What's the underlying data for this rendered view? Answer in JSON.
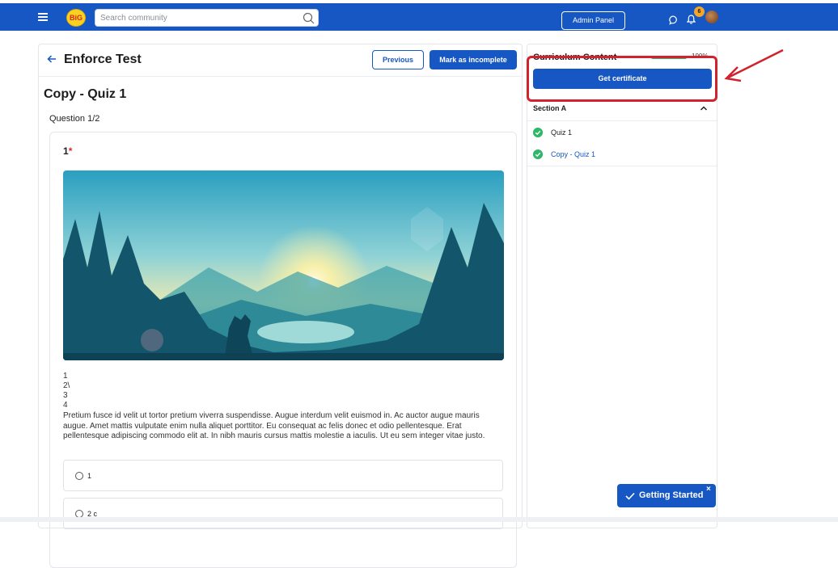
{
  "topbar": {
    "logo_text": "BiG",
    "search_placeholder": "Search community",
    "admin_label": "Admin Panel",
    "notification_count": "6"
  },
  "course": {
    "title": "Enforce Test",
    "previous_label": "Previous",
    "mark_label": "Mark as incomplete"
  },
  "quiz": {
    "title": "Copy - Quiz 1",
    "question_count": "Question 1/2",
    "question_number": "1",
    "required_mark": "*",
    "lines": [
      "1",
      "2\\",
      "3",
      "4"
    ],
    "paragraph": "Pretium fusce id velit ut tortor pretium viverra suspendisse. Augue interdum velit euismod in. Ac auctor augue mauris augue. Amet mattis vulputate enim nulla aliquet porttitor. Eu consequat ac felis donec et odio pellentesque. Erat pellentesque adipiscing commodo elit at. In nibh mauris cursus mattis molestie a iaculis. Ut eu sem integer vitae justo.",
    "options": [
      {
        "label": "1"
      },
      {
        "label": "2 c"
      }
    ]
  },
  "sidebar": {
    "title": "Curriculum Content",
    "progress_text": "100%",
    "progress_value": 100,
    "certificate_label": "Get certificate",
    "section_name": "Section A",
    "lessons": [
      {
        "label": "Quiz 1",
        "completed": true,
        "active": false
      },
      {
        "label": "Copy - Quiz 1",
        "completed": true,
        "active": true
      }
    ]
  },
  "getting_started": {
    "label": "Getting Started",
    "close": "×"
  },
  "colors": {
    "brand": "#1657c4",
    "success": "#2fb86a",
    "annotation": "#d2222d",
    "badge": "#f4a62a"
  }
}
